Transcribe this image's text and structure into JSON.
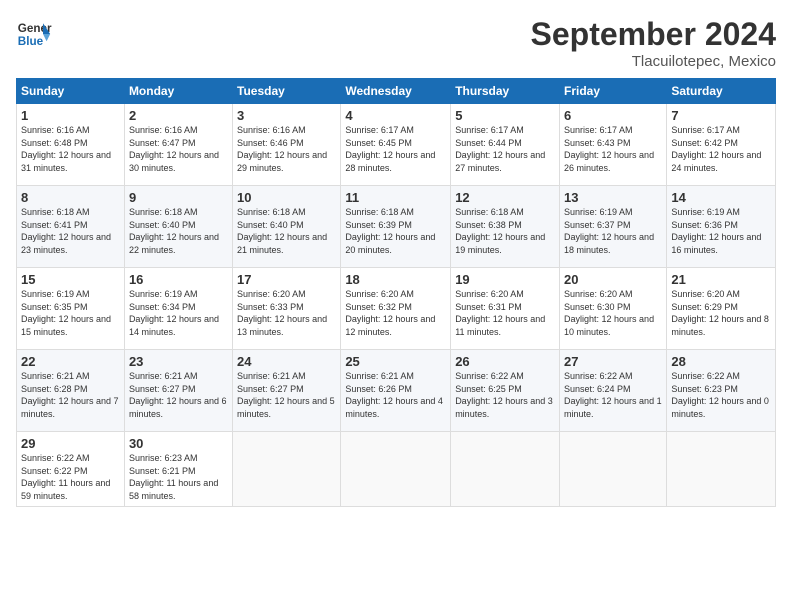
{
  "header": {
    "logo_line1": "General",
    "logo_line2": "Blue",
    "month": "September 2024",
    "location": "Tlacuilotepec, Mexico"
  },
  "weekdays": [
    "Sunday",
    "Monday",
    "Tuesday",
    "Wednesday",
    "Thursday",
    "Friday",
    "Saturday"
  ],
  "weeks": [
    [
      {
        "day": "1",
        "sunrise": "6:16 AM",
        "sunset": "6:48 PM",
        "daylight": "12 hours and 31 minutes."
      },
      {
        "day": "2",
        "sunrise": "6:16 AM",
        "sunset": "6:47 PM",
        "daylight": "12 hours and 30 minutes."
      },
      {
        "day": "3",
        "sunrise": "6:16 AM",
        "sunset": "6:46 PM",
        "daylight": "12 hours and 29 minutes."
      },
      {
        "day": "4",
        "sunrise": "6:17 AM",
        "sunset": "6:45 PM",
        "daylight": "12 hours and 28 minutes."
      },
      {
        "day": "5",
        "sunrise": "6:17 AM",
        "sunset": "6:44 PM",
        "daylight": "12 hours and 27 minutes."
      },
      {
        "day": "6",
        "sunrise": "6:17 AM",
        "sunset": "6:43 PM",
        "daylight": "12 hours and 26 minutes."
      },
      {
        "day": "7",
        "sunrise": "6:17 AM",
        "sunset": "6:42 PM",
        "daylight": "12 hours and 24 minutes."
      }
    ],
    [
      {
        "day": "8",
        "sunrise": "6:18 AM",
        "sunset": "6:41 PM",
        "daylight": "12 hours and 23 minutes."
      },
      {
        "day": "9",
        "sunrise": "6:18 AM",
        "sunset": "6:40 PM",
        "daylight": "12 hours and 22 minutes."
      },
      {
        "day": "10",
        "sunrise": "6:18 AM",
        "sunset": "6:40 PM",
        "daylight": "12 hours and 21 minutes."
      },
      {
        "day": "11",
        "sunrise": "6:18 AM",
        "sunset": "6:39 PM",
        "daylight": "12 hours and 20 minutes."
      },
      {
        "day": "12",
        "sunrise": "6:18 AM",
        "sunset": "6:38 PM",
        "daylight": "12 hours and 19 minutes."
      },
      {
        "day": "13",
        "sunrise": "6:19 AM",
        "sunset": "6:37 PM",
        "daylight": "12 hours and 18 minutes."
      },
      {
        "day": "14",
        "sunrise": "6:19 AM",
        "sunset": "6:36 PM",
        "daylight": "12 hours and 16 minutes."
      }
    ],
    [
      {
        "day": "15",
        "sunrise": "6:19 AM",
        "sunset": "6:35 PM",
        "daylight": "12 hours and 15 minutes."
      },
      {
        "day": "16",
        "sunrise": "6:19 AM",
        "sunset": "6:34 PM",
        "daylight": "12 hours and 14 minutes."
      },
      {
        "day": "17",
        "sunrise": "6:20 AM",
        "sunset": "6:33 PM",
        "daylight": "12 hours and 13 minutes."
      },
      {
        "day": "18",
        "sunrise": "6:20 AM",
        "sunset": "6:32 PM",
        "daylight": "12 hours and 12 minutes."
      },
      {
        "day": "19",
        "sunrise": "6:20 AM",
        "sunset": "6:31 PM",
        "daylight": "12 hours and 11 minutes."
      },
      {
        "day": "20",
        "sunrise": "6:20 AM",
        "sunset": "6:30 PM",
        "daylight": "12 hours and 10 minutes."
      },
      {
        "day": "21",
        "sunrise": "6:20 AM",
        "sunset": "6:29 PM",
        "daylight": "12 hours and 8 minutes."
      }
    ],
    [
      {
        "day": "22",
        "sunrise": "6:21 AM",
        "sunset": "6:28 PM",
        "daylight": "12 hours and 7 minutes."
      },
      {
        "day": "23",
        "sunrise": "6:21 AM",
        "sunset": "6:27 PM",
        "daylight": "12 hours and 6 minutes."
      },
      {
        "day": "24",
        "sunrise": "6:21 AM",
        "sunset": "6:27 PM",
        "daylight": "12 hours and 5 minutes."
      },
      {
        "day": "25",
        "sunrise": "6:21 AM",
        "sunset": "6:26 PM",
        "daylight": "12 hours and 4 minutes."
      },
      {
        "day": "26",
        "sunrise": "6:22 AM",
        "sunset": "6:25 PM",
        "daylight": "12 hours and 3 minutes."
      },
      {
        "day": "27",
        "sunrise": "6:22 AM",
        "sunset": "6:24 PM",
        "daylight": "12 hours and 1 minute."
      },
      {
        "day": "28",
        "sunrise": "6:22 AM",
        "sunset": "6:23 PM",
        "daylight": "12 hours and 0 minutes."
      }
    ],
    [
      {
        "day": "29",
        "sunrise": "6:22 AM",
        "sunset": "6:22 PM",
        "daylight": "11 hours and 59 minutes."
      },
      {
        "day": "30",
        "sunrise": "6:23 AM",
        "sunset": "6:21 PM",
        "daylight": "11 hours and 58 minutes."
      },
      null,
      null,
      null,
      null,
      null
    ]
  ]
}
